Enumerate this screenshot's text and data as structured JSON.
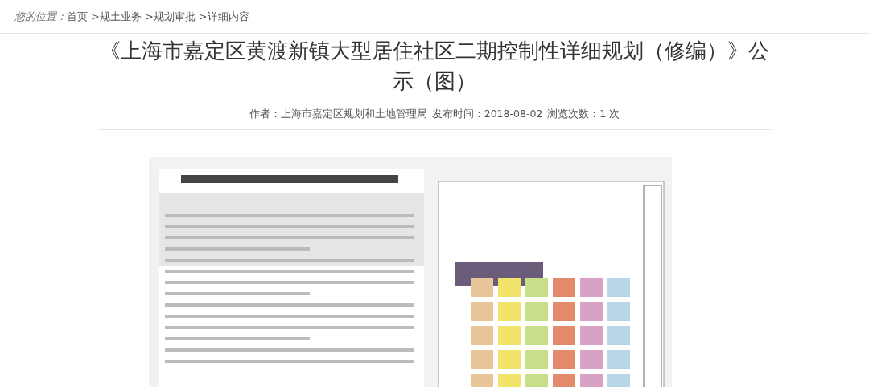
{
  "breadcrumb": {
    "label": "您的位置：",
    "items": [
      {
        "label": "首页"
      },
      {
        "label": ">规土业务"
      },
      {
        "label": ">规划审批"
      },
      {
        "label": ">详细内容"
      }
    ]
  },
  "article": {
    "title": "《上海市嘉定区黄渡新镇大型居住社区二期控制性详细规划（修编）》公示（图）",
    "author": "作者：上海市嘉定区规划和土地管理局",
    "published": "发布时间：2018-08-02",
    "views": "浏览次数：1 次"
  }
}
